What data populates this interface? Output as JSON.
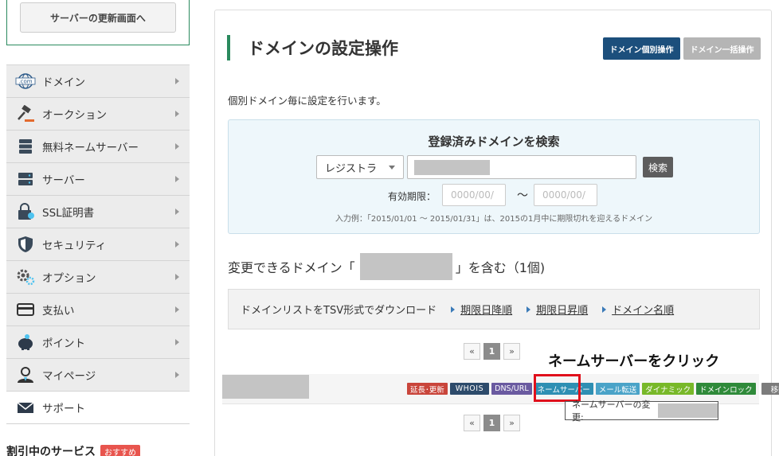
{
  "sidebar": {
    "update_button": "サーバーの更新画面へ",
    "items": [
      {
        "label": "ドメイン",
        "icon": "globe-com-icon"
      },
      {
        "label": "オークション",
        "icon": "gavel-icon"
      },
      {
        "label": "無料ネームサーバー",
        "icon": "server-stack-icon"
      },
      {
        "label": "サーバー",
        "icon": "server-icon"
      },
      {
        "label": "SSL証明書",
        "icon": "ssl-lock-icon"
      },
      {
        "label": "セキュリティ",
        "icon": "shield-icon"
      },
      {
        "label": "オプション",
        "icon": "gears-icon"
      },
      {
        "label": "支払い",
        "icon": "credit-card-icon"
      },
      {
        "label": "ポイント",
        "icon": "piggy-bank-icon"
      },
      {
        "label": "マイページ",
        "icon": "user-icon"
      },
      {
        "label": "サポート",
        "icon": "mail-icon"
      }
    ],
    "bottom_heading": "割引中のサービス",
    "bottom_badge": "おすすめ"
  },
  "main": {
    "title": "ドメインの設定操作",
    "tab_individual": "ドメイン個別操作",
    "tab_bulk": "ドメイン一括操作",
    "description": "個別ドメイン毎に設定を行います。",
    "search": {
      "heading": "登録済みドメインを検索",
      "select_value": "レジストラ",
      "button": "検索",
      "expiry_label": "有効期限：",
      "date_from_placeholder": "0000/00/",
      "tilde": "～",
      "date_to_placeholder": "0000/00/",
      "example": "入力例：「2015/01/01 ～ 2015/01/31」は、2015の1月中に期限切れを迎えるドメイン"
    },
    "result": {
      "prefix": "変更できるドメイン「",
      "suffix": "」を含む（1個)"
    },
    "download": {
      "label": "ドメインリストをTSV形式でダウンロード",
      "links": [
        "期限日降順",
        "期限日昇順",
        "ドメイン名順"
      ]
    },
    "pager": {
      "prev": "«",
      "current": "1",
      "next": "»"
    },
    "annotation": "ネームサーバーをクリック",
    "row_actions": {
      "renew": "延長･更新",
      "whois": "WHOIS",
      "dns": "DNS/URL",
      "nameserver": "ネームサーバー",
      "mail": "メール転送",
      "dynamic": "ダイナミック",
      "lock": "ドメインロック",
      "move": "移動"
    },
    "tooltip": "ネームサーバーの変更:"
  },
  "colors": {
    "accent_green": "#2a8a5e",
    "tab_active": "#1c4f7c",
    "highlight_red": "#e0101c"
  }
}
